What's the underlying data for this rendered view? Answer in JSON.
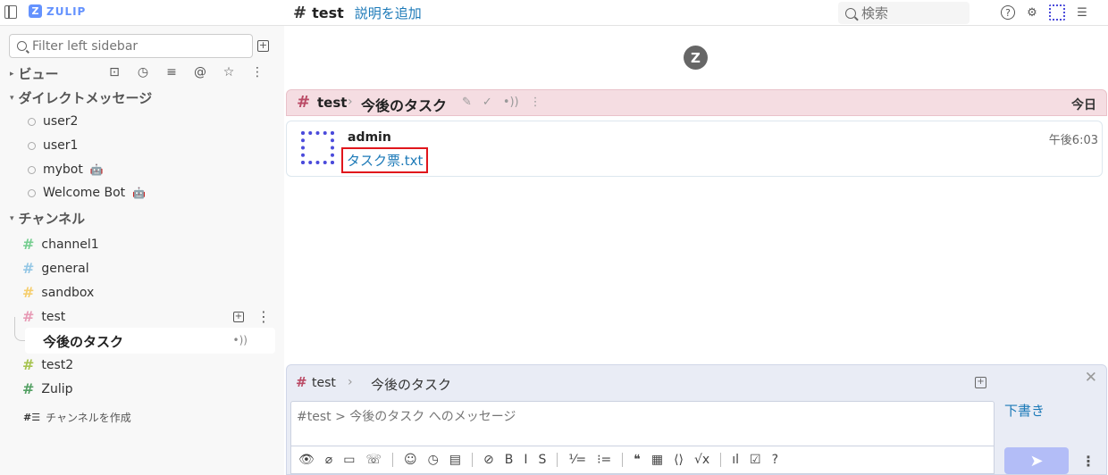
{
  "app": {
    "logo_text": "ZULIP",
    "logo_mark": "Z",
    "accent_color": "#6492fe"
  },
  "topbar": {
    "hash": "#",
    "stream": "test",
    "add_description": "説明を追加",
    "search_placeholder": "検索",
    "icons": [
      "sidebar-toggle-icon",
      "help-icon",
      "gear-icon",
      "user-avatar-icon",
      "user-list-icon"
    ],
    "help_glyph": "?",
    "gear_glyph": "⚙",
    "userlist_glyph": "☰"
  },
  "sidebar": {
    "filter_placeholder": "Filter left sidebar",
    "add_glyph": "+",
    "views_caret": "▸",
    "views_title": "ビュー",
    "views_icons": [
      "inbox-icon",
      "recent-icon",
      "feed-icon",
      "mentions-icon",
      "starred-icon",
      "more-icon"
    ],
    "views_glyphs": [
      "⊡",
      "◷",
      "≡",
      "@",
      "☆",
      "⋮"
    ],
    "dm_caret": "▾",
    "dm_title": "ダイレクトメッセージ",
    "dms": [
      {
        "name": "user2",
        "bot": false
      },
      {
        "name": "user1",
        "bot": false
      },
      {
        "name": "mybot",
        "bot": true
      },
      {
        "name": "Welcome Bot",
        "bot": true
      }
    ],
    "bot_glyph": "🤖",
    "channels_caret": "▾",
    "channels_title": "チャンネル",
    "channels": [
      {
        "name": "channel1",
        "color": "#76ce90"
      },
      {
        "name": "general",
        "color": "#94c7e5"
      },
      {
        "name": "sandbox",
        "color": "#f5ce6e"
      },
      {
        "name": "test",
        "color": "#e79ab5"
      },
      {
        "name": "test2",
        "color": "#a6c34f"
      },
      {
        "name": "Zulip",
        "color": "#53a063"
      }
    ],
    "hash_glyph": "#",
    "active_topic": "今後のタスク",
    "wave_glyph": "•))",
    "more_glyph": "⋮",
    "create_channel_icon": "#☰",
    "create_channel": "チャンネルを作成"
  },
  "recipient_bar": {
    "hash": "#",
    "stream": "test",
    "separator": "›",
    "topic": "今後のタスク",
    "topic_icons": [
      "✎",
      "✓",
      "•))",
      "⋮"
    ],
    "date": "今日",
    "stream_color": "#ba4a65"
  },
  "message": {
    "sender": "admin",
    "time": "午後6:03",
    "attachment": "タスク票.txt"
  },
  "center_logo": "Z",
  "compose": {
    "hash": "#",
    "stream": "test",
    "separator": "›",
    "topic": "今後のタスク",
    "expand_glyph": "+",
    "close_glyph": "✕",
    "placeholder": "#test > 今後のタスク へのメッセージ",
    "drafts": "下書き",
    "send_glyph": "➤",
    "more_glyph": "⋮",
    "toolbar": [
      {
        "name": "preview-icon",
        "glyph": "👁"
      },
      {
        "name": "attach-icon",
        "glyph": "⌀"
      },
      {
        "name": "video-call-icon",
        "glyph": "▭"
      },
      {
        "name": "voice-call-icon",
        "glyph": "☏"
      },
      {
        "name": "divider",
        "glyph": ""
      },
      {
        "name": "emoji-icon",
        "glyph": "☺"
      },
      {
        "name": "time-icon",
        "glyph": "◷"
      },
      {
        "name": "poll-icon",
        "glyph": "▤"
      },
      {
        "name": "divider",
        "glyph": ""
      },
      {
        "name": "link-icon",
        "glyph": "⊘"
      },
      {
        "name": "bold-icon",
        "glyph": "B"
      },
      {
        "name": "italic-icon",
        "glyph": "I"
      },
      {
        "name": "strikethrough-icon",
        "glyph": "S"
      },
      {
        "name": "divider",
        "glyph": ""
      },
      {
        "name": "numbered-list-icon",
        "glyph": "⅟="
      },
      {
        "name": "bullet-list-icon",
        "glyph": "⁝="
      },
      {
        "name": "divider",
        "glyph": ""
      },
      {
        "name": "quote-icon",
        "glyph": "❝"
      },
      {
        "name": "spoiler-icon",
        "glyph": "▦"
      },
      {
        "name": "code-icon",
        "glyph": "⟨⟩"
      },
      {
        "name": "math-icon",
        "glyph": "√x"
      },
      {
        "name": "divider",
        "glyph": ""
      },
      {
        "name": "chart-icon",
        "glyph": "ıl"
      },
      {
        "name": "todo-icon",
        "glyph": "☑"
      },
      {
        "name": "help-icon",
        "glyph": "?"
      }
    ]
  }
}
